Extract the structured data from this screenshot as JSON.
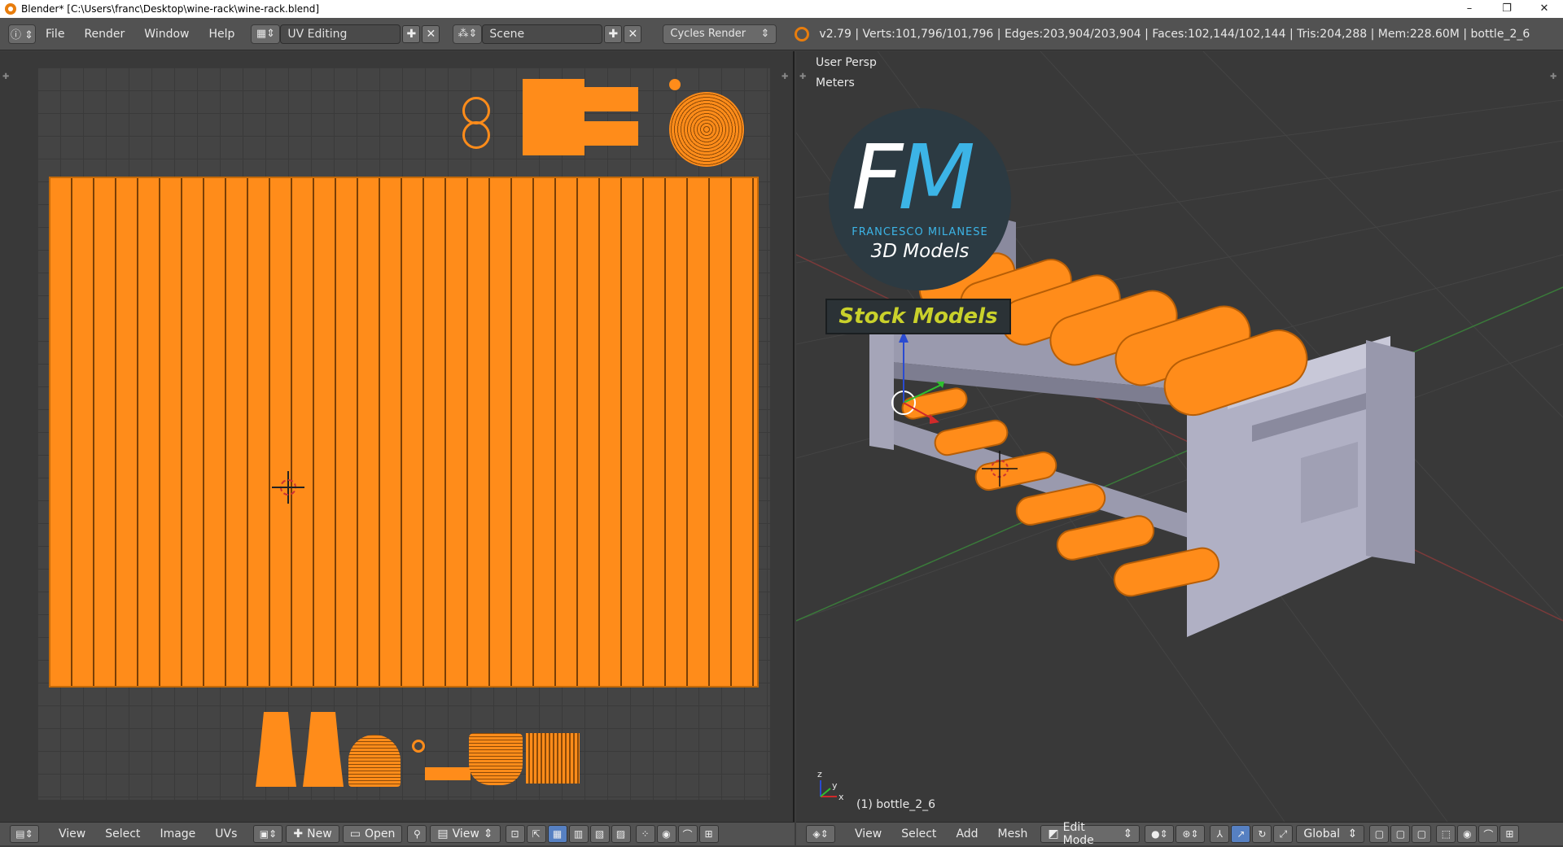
{
  "window": {
    "title": "Blender* [C:\\Users\\franc\\Desktop\\wine-rack\\wine-rack.blend]",
    "controls": {
      "minimize": "–",
      "maximize": "❐",
      "close": "✕"
    }
  },
  "info_header": {
    "menus": [
      "File",
      "Render",
      "Window",
      "Help"
    ],
    "layout": "UV Editing",
    "scene": "Scene",
    "engine": "Cycles Render",
    "stats": "v2.79 | Verts:101,796/101,796 | Edges:203,904/203,904 | Faces:102,144/102,144 | Tris:204,288 | Mem:228.60M | bottle_2_6"
  },
  "viewport": {
    "view_name": "User Persp",
    "units": "Meters",
    "object_label": "(1) bottle_2_6",
    "axis_x": "x",
    "axis_y": "y",
    "axis_z": "z"
  },
  "logo": {
    "letters_f": "F",
    "letters_m": "M",
    "author": "FRANCESCO MILANESE",
    "tagline": "3D Models",
    "banner": "Stock Models",
    "colors": {
      "circle": "#2c3a42",
      "m": "#3cb4e6",
      "banner_text": "#c9d12b"
    }
  },
  "uv_footer": {
    "menus": [
      "View",
      "Select",
      "Image",
      "UVs"
    ],
    "new_label": "New",
    "open_label": "Open",
    "view_label": "View"
  },
  "vp_footer": {
    "menus": [
      "View",
      "Select",
      "Add",
      "Mesh"
    ],
    "mode": "Edit Mode",
    "orientation": "Global"
  },
  "colors": {
    "accent": "#ff8c1a",
    "header": "#525252",
    "background": "#393939"
  }
}
